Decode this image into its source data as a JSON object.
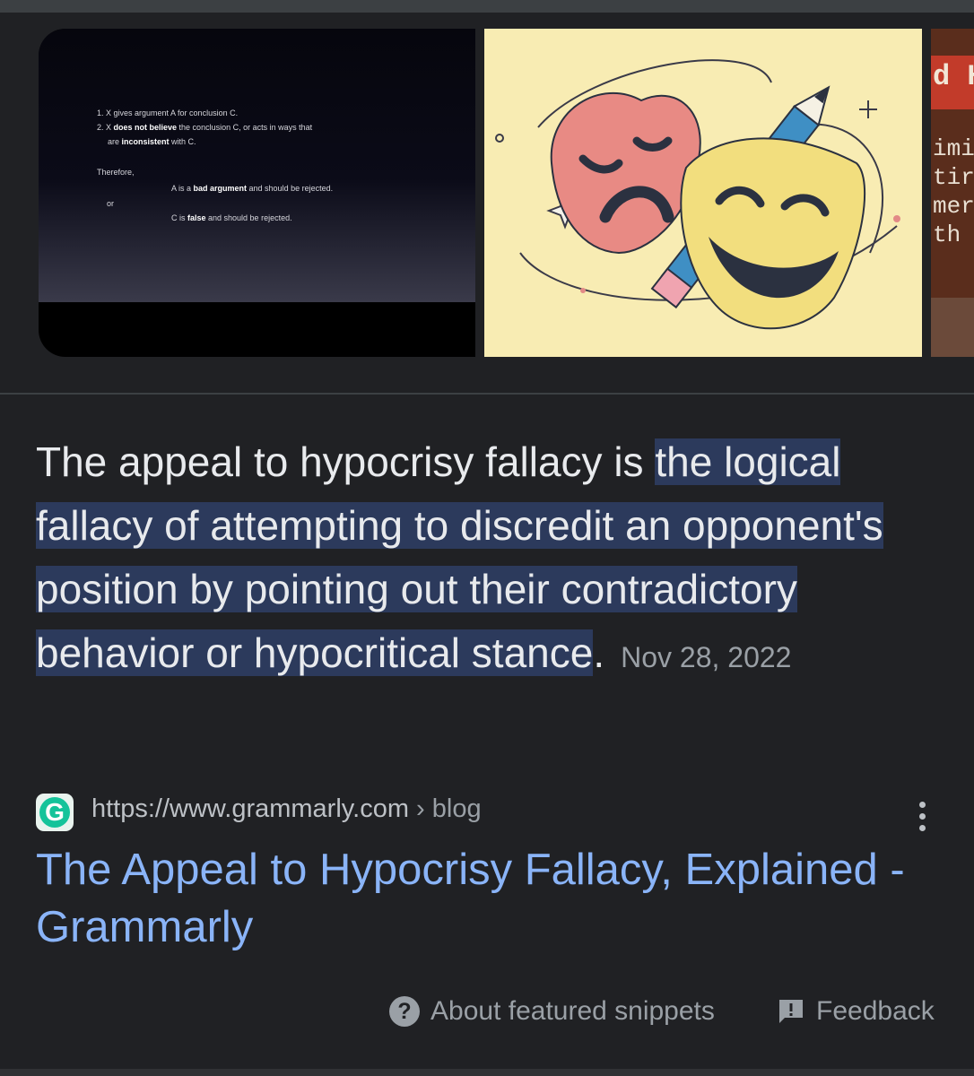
{
  "carousel": {
    "slide": {
      "line1": "1. X gives argument A for conclusion C.",
      "line2_pre": "2. X ",
      "line2_bold": "does not believe",
      "line2_post": " the conclusion C, or acts in ways that",
      "line3_pre": "are ",
      "line3_bold": "inconsistent",
      "line3_post": " with C.",
      "therefore": "Therefore,",
      "opt_a_pre": "A is a ",
      "opt_a_bold": "bad argument",
      "opt_a_post": " and should be rejected.",
      "or": "or",
      "opt_c_pre": "C is ",
      "opt_c_bold": "false",
      "opt_c_post": " and should be rejected."
    },
    "third_thumb_letters": [
      "d H",
      "imi",
      "tir",
      "mer",
      "th"
    ]
  },
  "snippet": {
    "text_plain": "The appeal to hypocrisy fallacy is ",
    "text_highlighted": "the logical fallacy of attempting to discredit an opponent's position by pointing out their contradictory behavior or hypocritical stance",
    "text_end": ".",
    "date": "Nov 28, 2022"
  },
  "source": {
    "favicon_letter": "G",
    "url": "https://www.grammarly.com",
    "breadcrumb": " › blog",
    "title": "The Appeal to Hypocrisy Fallacy, Explained - Grammarly"
  },
  "footer": {
    "about_icon": "?",
    "about_label": "About featured snippets",
    "feedback_label": "Feedback"
  },
  "icons": {
    "about": "question-circle-icon",
    "feedback": "feedback-icon",
    "more": "more-vert-icon"
  },
  "colors": {
    "background": "#202124",
    "highlight": "#2c3a5c",
    "link": "#8ab4f8",
    "muted": "#9aa0a6",
    "grammarly": "#15c39a"
  }
}
